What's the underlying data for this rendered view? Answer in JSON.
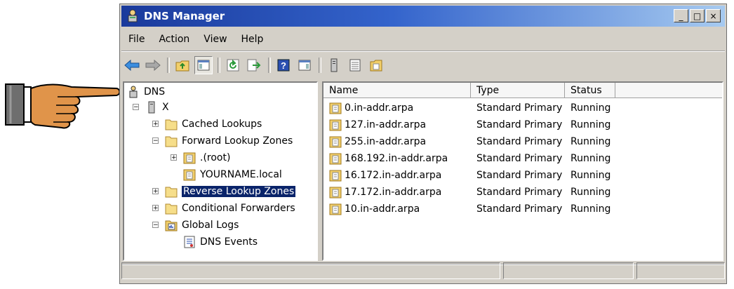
{
  "window": {
    "title": "DNS Manager",
    "buttons": {
      "minimize": "_",
      "maximize": "□",
      "close": "×"
    }
  },
  "menu": [
    "File",
    "Action",
    "View",
    "Help"
  ],
  "toolbar": {
    "icons": [
      "back-arrow-icon",
      "forward-arrow-icon",
      "up-folder-icon",
      "show-hide-tree-icon",
      "refresh-icon",
      "export-list-icon",
      "help-icon",
      "action-pane-icon",
      "server-icon",
      "list-icon",
      "folder-icon"
    ]
  },
  "tree": {
    "root": "DNS",
    "server": "X",
    "cached": "Cached Lookups",
    "forward": "Forward Lookup Zones",
    "root_zone": ".(root)",
    "local_zone": "YOURNAME.local",
    "reverse": "Reverse Lookup Zones",
    "conditional": "Conditional Forwarders",
    "global_logs": "Global Logs",
    "dns_events": "DNS Events"
  },
  "list": {
    "headers": {
      "name": "Name",
      "type": "Type",
      "status": "Status"
    },
    "rows": [
      {
        "name": "0.in-addr.arpa",
        "type": "Standard Primary",
        "status": "Running"
      },
      {
        "name": "127.in-addr.arpa",
        "type": "Standard Primary",
        "status": "Running"
      },
      {
        "name": "255.in-addr.arpa",
        "type": "Standard Primary",
        "status": "Running"
      },
      {
        "name": "168.192.in-addr.arpa",
        "type": "Standard Primary",
        "status": "Running"
      },
      {
        "name": "16.172.in-addr.arpa",
        "type": "Standard Primary",
        "status": "Running"
      },
      {
        "name": "17.172.in-addr.arpa",
        "type": "Standard Primary",
        "status": "Running"
      },
      {
        "name": "10.in-addr.arpa",
        "type": "Standard Primary",
        "status": "Running"
      }
    ]
  },
  "colors": {
    "titlebar_start": "#1a3a9c",
    "titlebar_end": "#a6caf0",
    "selection": "#0a246a",
    "chrome": "#d4d0c8"
  }
}
